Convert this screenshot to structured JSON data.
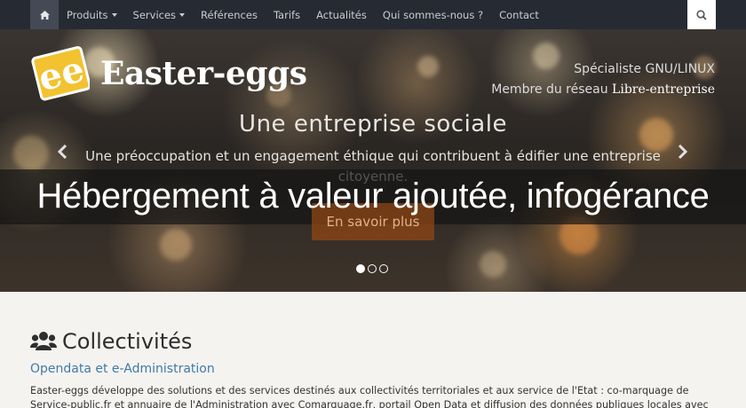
{
  "nav": {
    "items": [
      {
        "label": "Produits",
        "dropdown": true
      },
      {
        "label": "Services",
        "dropdown": true
      },
      {
        "label": "Références",
        "dropdown": false
      },
      {
        "label": "Tarifs",
        "dropdown": false
      },
      {
        "label": "Actualités",
        "dropdown": false
      },
      {
        "label": "Qui sommes-nous ?",
        "dropdown": false
      },
      {
        "label": "Contact",
        "dropdown": false
      }
    ],
    "home_icon": "home-icon",
    "search_icon": "search-icon"
  },
  "brand": {
    "name": "Easter-eggs",
    "logo_letters": "ee",
    "tagline_line1": "Spécialiste GNU/LINUX",
    "tagline_line2_prefix": "Membre du réseau",
    "tagline_line2_strong": "Libre-entreprise"
  },
  "carousel": {
    "title": "Une entreprise sociale",
    "text": "Une préoccupation et un engagement éthique qui contribuent à édifier une entreprise citoyenne.",
    "button_label": "En savoir plus",
    "slide_count": 3,
    "active_slide": 1
  },
  "banner": {
    "text": "Hébergement à valeur ajoutée, infogérance"
  },
  "section": {
    "icon": "users-icon",
    "title": "Collectivités",
    "subtitle": "Opendata et e-Administration",
    "description": "Easter-eggs développe des solutions et des services destinés aux collectivités territoriales et aux service de l'Etat : co-marquage de Service-public.fr et annuaire de l'Administration avec Comarquage.fr, portail Open Data et diffusion des données publiques locales avec"
  },
  "colors": {
    "navbar": "#262b33",
    "accent_link": "#3f7aa8",
    "logo_yellow": "#f2c230",
    "button_bg": "#964814"
  }
}
